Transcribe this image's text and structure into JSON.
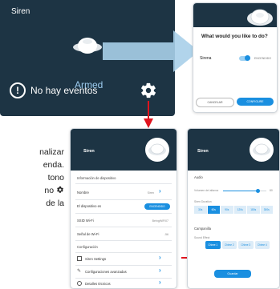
{
  "tile": {
    "title": "Siren",
    "status": "No hay eventos",
    "armed": "Armed",
    "info_glyph": "!"
  },
  "dialog": {
    "question": "What would you like to do?",
    "siren_label": "Sirena",
    "state": "ENCENDIDO",
    "cancel": "CANCELAR",
    "configure": "CONFIGURE"
  },
  "left_text": {
    "line1": "nalizar",
    "line2": "enda.",
    "line3": "tono",
    "line4_prefix": "no",
    "line5": "de la"
  },
  "settings": {
    "title": "Siren",
    "section_info": "Información de dispositivo",
    "rows": [
      {
        "label": "Nombre",
        "value": "Siren"
      },
      {
        "label": "El dispositivo es",
        "value": "ENCENDIDO"
      },
      {
        "label": "SSID Wi-Fi",
        "value": "BeingWiFi07"
      },
      {
        "label": "Señal de Wi-Fi",
        "value": "-56"
      }
    ],
    "section_config": "Configuración",
    "config_rows": [
      {
        "label": "Siren Settings"
      },
      {
        "label": "Configuraciones avanzadas"
      },
      {
        "label": "Detalles técnicos"
      }
    ]
  },
  "siren_settings": {
    "title": "Siren",
    "audio": "Audio",
    "volume_label": "Volumen del altavoz",
    "volume_value": "80",
    "volume_level": 0.8,
    "duration_label": "Siren Duration",
    "durations": [
      "30s",
      "60s",
      "90s",
      "120s",
      "180s",
      "300s"
    ],
    "duration_selected": 1,
    "chime": "Campanilla",
    "sound_label": "Sound Effect",
    "sounds": [
      "Chime 1",
      "Chime 2",
      "Chime 3",
      "Chime 4"
    ],
    "sound_selected": 0,
    "save": "Guardar"
  },
  "colors": {
    "navy": "#1d3444",
    "accent": "#1a8fe0",
    "red_arrow": "#e0141e",
    "light_arrow": "#a9cfe9"
  }
}
